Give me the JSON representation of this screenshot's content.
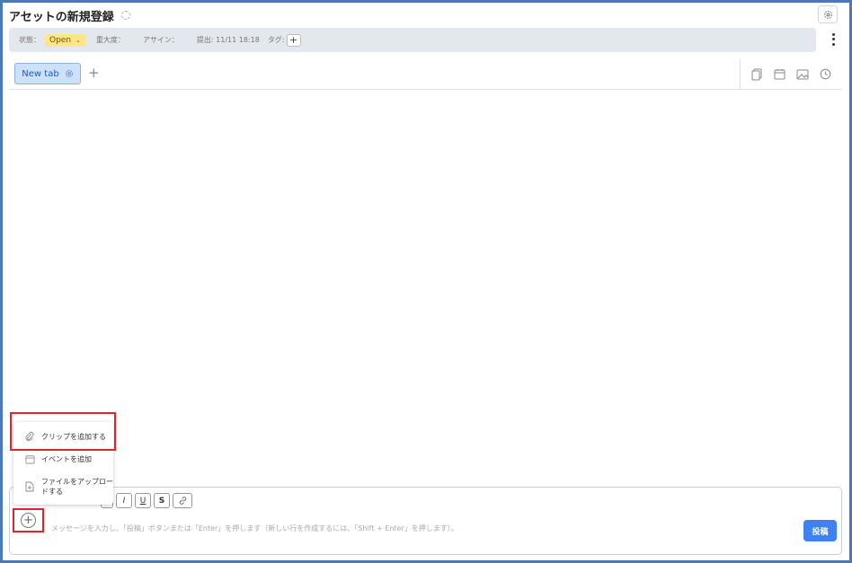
{
  "header": {
    "title": "アセットの新規登録"
  },
  "meta": {
    "status_label": "状態：",
    "status_value": "Open",
    "severity_label": "重大度：",
    "assign_label": "アサイン：",
    "submitted": "提出: 11/11 18:18",
    "tags_label": "タグ:",
    "add_symbol": "+"
  },
  "tabs": {
    "items": [
      {
        "label": "New tab"
      }
    ],
    "add_symbol": "+"
  },
  "menu": {
    "items": [
      {
        "label": "クリップを追加する",
        "icon": "paperclip-icon"
      },
      {
        "label": "イベントを追加",
        "icon": "calendar-icon"
      },
      {
        "label_line1": "ファイルをアップロー",
        "label_line2": "ドする",
        "icon": "file-upload-icon"
      }
    ]
  },
  "composer": {
    "format_buttons": [
      "I",
      "U",
      "S"
    ],
    "placeholder": "メッセージを入力し、「投稿」ボタンまたは「Enter」を押します（新しい行を作成するには、「Shift + Enter」を押します）。",
    "post_label": "投稿",
    "add_symbol": "+"
  },
  "colors": {
    "accent": "#3d82f0",
    "status_bg": "#ffe58a",
    "highlight": "#e0242c",
    "frame": "#4a78b8"
  }
}
